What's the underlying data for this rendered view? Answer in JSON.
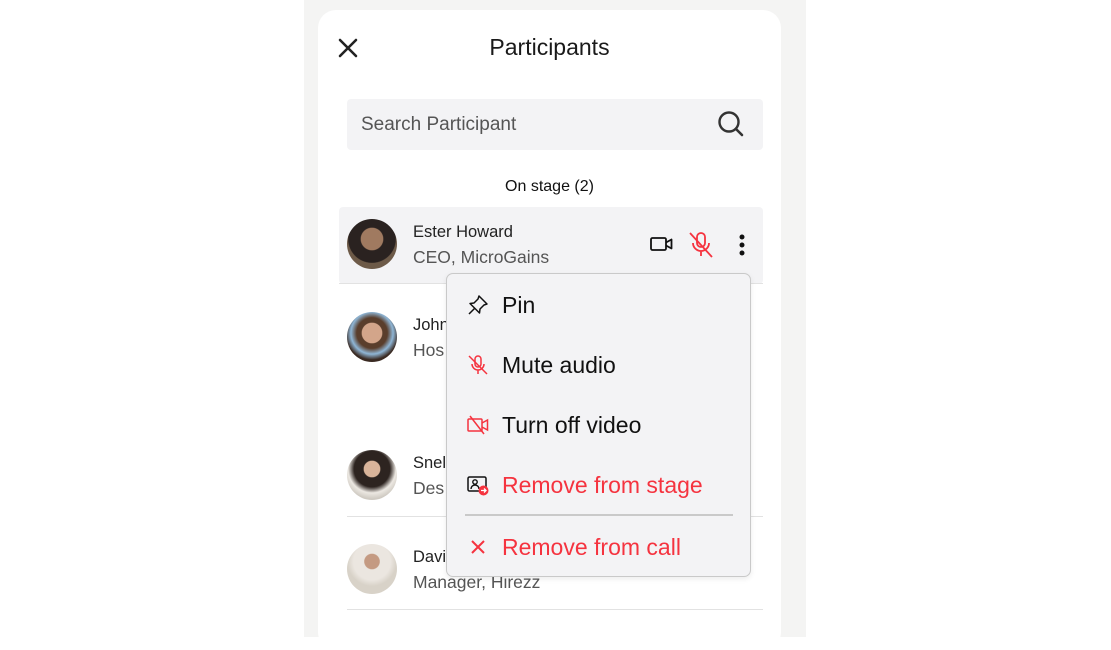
{
  "header": {
    "title": "Participants",
    "close_icon": "close-icon"
  },
  "search": {
    "placeholder": "Search Participant",
    "value": "",
    "icon": "search-icon"
  },
  "section": {
    "label": "On stage (2)"
  },
  "participants": [
    {
      "name": "Ester Howard",
      "role": "CEO, MicroGains",
      "video": "on",
      "audio": "muted"
    },
    {
      "name": "John",
      "role": "Hos"
    },
    {
      "name": "Snel",
      "role": "Des"
    },
    {
      "name": "Davi",
      "role": "Manager, Hirezz"
    }
  ],
  "menu": {
    "items": [
      {
        "label": "Pin",
        "icon": "pin-icon"
      },
      {
        "label": "Mute audio",
        "icon": "mic-off-icon"
      },
      {
        "label": "Turn off video",
        "icon": "video-off-icon"
      },
      {
        "label": "Remove from stage",
        "icon": "remove-from-stage-icon"
      },
      {
        "label": "Remove from call",
        "icon": "close-icon"
      }
    ]
  },
  "colors": {
    "danger": "#f5333f",
    "panel_bg": "#ffffff",
    "surface": "#f3f3f5"
  }
}
